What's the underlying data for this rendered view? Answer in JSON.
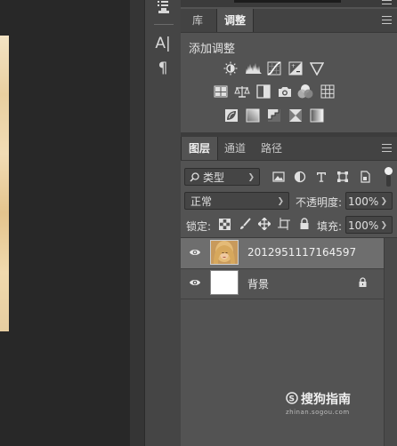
{
  "left_toolbar": {
    "icons": [
      "clone-stamp-icon",
      "character-icon",
      "paragraph-icon"
    ],
    "character_glyph": "A|",
    "paragraph_glyph": "¶"
  },
  "adjust_panel": {
    "tabs": [
      {
        "label": "库"
      },
      {
        "label": "调整"
      }
    ],
    "active_tab": "调整",
    "title": "添加调整",
    "rows": [
      [
        "brightness-contrast-icon",
        "levels-icon",
        "curves-icon",
        "exposure-icon",
        "vibrance-icon"
      ],
      [
        "hue-saturation-icon",
        "color-balance-icon",
        "black-white-icon",
        "photo-filter-icon",
        "channel-mixer-icon",
        "color-lookup-icon"
      ],
      [
        "invert-icon",
        "posterize-icon",
        "threshold-icon",
        "selective-color-icon",
        "gradient-map-icon"
      ]
    ]
  },
  "layers_panel": {
    "tabs": [
      {
        "label": "图层"
      },
      {
        "label": "通道"
      },
      {
        "label": "路径"
      }
    ],
    "active_tab": "图层",
    "filter": {
      "label": "类型",
      "icon": "search-icon"
    },
    "filter_icons": [
      "pixel-filter-icon",
      "adjustment-filter-icon",
      "type-filter-icon",
      "shape-filter-icon",
      "smart-object-filter-icon"
    ],
    "blend_mode": "正常",
    "opacity_label": "不透明度:",
    "opacity_value": "100%",
    "lock_label": "锁定:",
    "fill_label": "填充:",
    "fill_value": "100%",
    "layers": [
      {
        "name": "2012951117164597",
        "selected": true,
        "visible": true,
        "locked": false
      },
      {
        "name": "背景",
        "selected": false,
        "visible": true,
        "locked": true
      }
    ]
  },
  "watermark": {
    "name": "搜狗指南",
    "url": "zhinan.sogou.com"
  },
  "colors": {
    "panel_bg": "#535353",
    "tab_bg": "#434343",
    "selected_row": "#6e6e6e",
    "canvas_bg": "#282828"
  }
}
